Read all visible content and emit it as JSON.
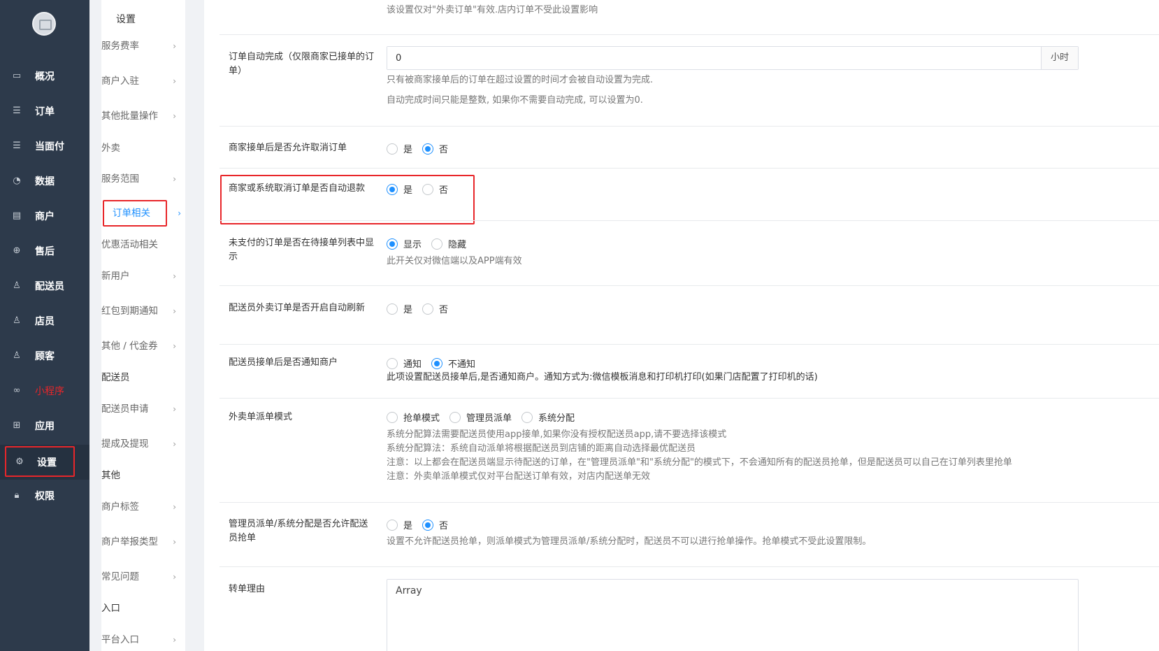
{
  "nav": {
    "items": [
      {
        "label": "概况",
        "icon": "dashboard-icon"
      },
      {
        "label": "订单",
        "icon": "order-icon"
      },
      {
        "label": "当面付",
        "icon": "pay-icon"
      },
      {
        "label": "数据",
        "icon": "chart-icon"
      },
      {
        "label": "商户",
        "icon": "store-icon"
      },
      {
        "label": "售后",
        "icon": "aftersale-icon"
      },
      {
        "label": "配送员",
        "icon": "courier-icon"
      },
      {
        "label": "店员",
        "icon": "clerk-icon"
      },
      {
        "label": "顾客",
        "icon": "customer-icon"
      },
      {
        "label": "小程序",
        "icon": "miniprogram-icon"
      },
      {
        "label": "应用",
        "icon": "apps-icon"
      },
      {
        "label": "设置",
        "icon": "gear-icon"
      },
      {
        "label": "权限",
        "icon": "lock-icon"
      }
    ],
    "active_color": "#253140",
    "highlight_color": "#e8262a"
  },
  "submenu": {
    "title": "设置",
    "items": [
      {
        "label": "服务费率",
        "chev": "›"
      },
      {
        "label": "商户入驻",
        "chev": "›"
      },
      {
        "label": "其他批量操作",
        "chev": "›"
      },
      {
        "label": "外卖",
        "chev": ""
      },
      {
        "label": "服务范围",
        "chev": "›"
      },
      {
        "label": "订单相关",
        "chev": "›"
      },
      {
        "label": "优惠活动相关",
        "chev": ""
      },
      {
        "label": "新用户",
        "chev": "›"
      },
      {
        "label": "红包到期通知",
        "chev": "›"
      },
      {
        "label": "其他 / 代金券",
        "chev": "›"
      },
      {
        "label": "配送员",
        "chev": ""
      },
      {
        "label": "配送员申请",
        "chev": "›"
      },
      {
        "label": "提成及提现",
        "chev": "›"
      },
      {
        "label": "其他",
        "chev": ""
      },
      {
        "label": "商户标签",
        "chev": "›"
      },
      {
        "label": "商户举报类型",
        "chev": "›"
      },
      {
        "label": "常见问题",
        "chev": "›"
      },
      {
        "label": "入口",
        "chev": ""
      },
      {
        "label": "平台入口",
        "chev": "›"
      }
    ],
    "accent": "#1e90ff"
  },
  "settings": {
    "top_hint": "该设置仅对\"外卖订单\"有效.店内订单不受此设置影响",
    "auto_complete": {
      "label": "订单自动完成（仅限商家已接单的订单）",
      "value": "0",
      "unit": "小时",
      "hint1": "只有被商家接单后的订单在超过设置的时间才会被自动设置为完成.",
      "hint2": "自动完成时间只能是整数, 如果你不需要自动完成, 可以设置为0."
    },
    "allow_cancel": {
      "label": "商家接单后是否允许取消订单",
      "opt_yes": "是",
      "opt_no": "否",
      "selected": "否"
    },
    "auto_refund": {
      "label": "商家或系统取消订单是否自动退款",
      "opt_yes": "是",
      "opt_no": "否",
      "selected": "是"
    },
    "unpaid_show": {
      "label": "未支付的订单是否在待接单列表中显示",
      "opt_show": "显示",
      "opt_hide": "隐藏",
      "selected": "显示",
      "hint": "此开关仅对微信端以及APP端有效"
    },
    "courier_refresh": {
      "label": "配送员外卖订单是否开启自动刷新",
      "opt_yes": "是",
      "opt_no": "否",
      "selected": ""
    },
    "notify_merchant": {
      "label": "配送员接单后是否通知商户",
      "opt_notify": "通知",
      "opt_no_notify": "不通知",
      "selected": "不通知",
      "hint": "此项设置配送员接单后,是否通知商户。通知方式为:微信模板消息和打印机打印(如果门店配置了打印机的话)"
    },
    "dispatch_mode": {
      "label": "外卖单派单模式",
      "opt_grab": "抢单模式",
      "opt_admin": "管理员派单",
      "opt_system": "系统分配",
      "selected": "",
      "hint1": "系统分配算法需要配送员使用app接单,如果你没有授权配送员app,请不要选择该模式",
      "hint2": "系统分配算法：系统自动派单将根据配送员到店铺的距离自动选择最优配送员",
      "hint3": "注意：以上都会在配送员端显示待配送的订单，在\"管理员派单\"和\"系统分配\"的模式下，不会通知所有的配送员抢单，但是配送员可以自己在订单列表里抢单",
      "hint4": "注意：外卖单派单模式仅对平台配送订单有效，对店内配送单无效"
    },
    "admin_grab": {
      "label": "管理员派单/系统分配是否允许配送员抢单",
      "opt_yes": "是",
      "opt_no": "否",
      "selected": "否",
      "hint": "设置不允许配送员抢单，则派单模式为管理员派单/系统分配时，配送员不可以进行抢单操作。抢单模式不受此设置限制。"
    },
    "transfer_reason": {
      "label": "转单理由",
      "value": "Array"
    }
  }
}
